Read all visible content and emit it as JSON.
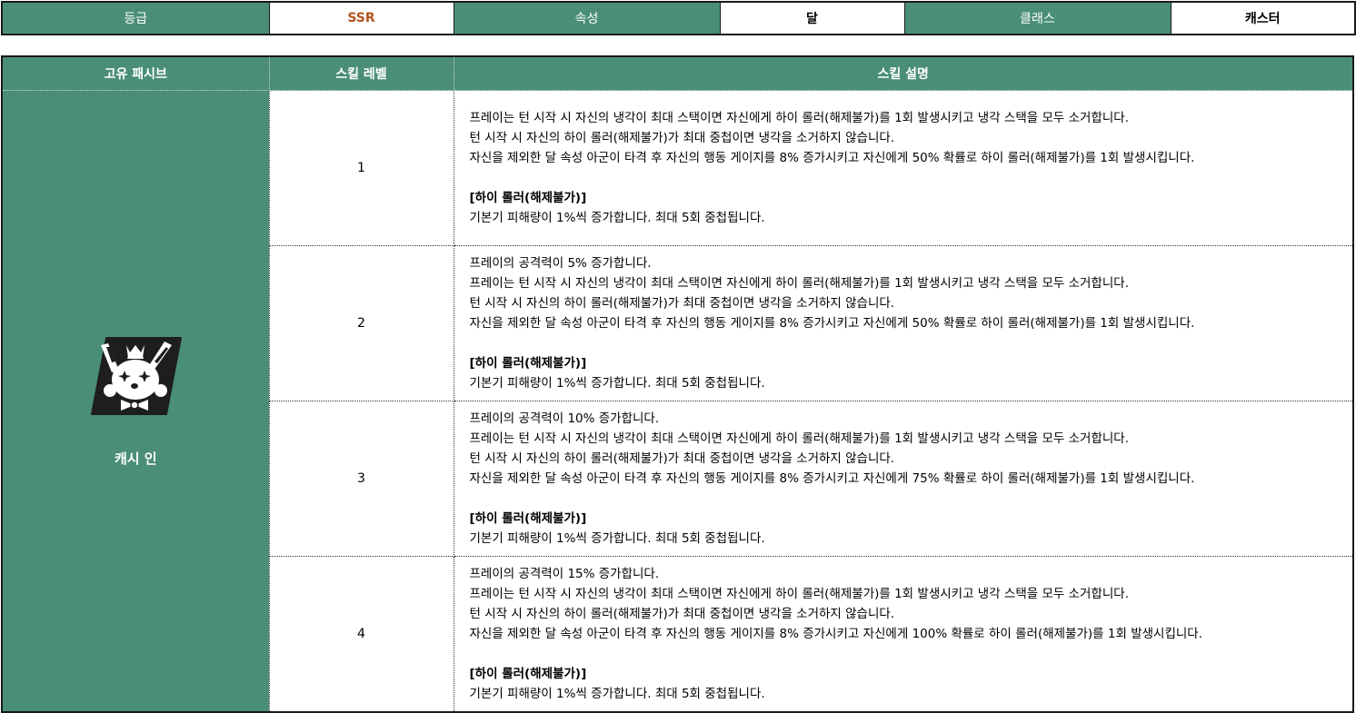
{
  "info": {
    "grade_label": "등급",
    "grade_value": "SSR",
    "attribute_label": "속성",
    "attribute_value": "달",
    "class_label": "클래스",
    "class_value": "캐스터"
  },
  "skill_table": {
    "headers": {
      "passive": "고유 패시브",
      "level": "스킬 레벨",
      "description": "스킬 설명"
    },
    "passive_name": "캐시 인",
    "passive_icon": "rabbit-card-icon",
    "rows": [
      {
        "level": "1",
        "lines": [
          "프레이는 턴 시작 시 자신의 냉각이 최대 스택이면 자신에게 하이 롤러(해제불가)를 1회 발생시키고 냉각 스택을 모두 소거합니다.",
          "턴 시작 시 자신의 하이 롤러(해제불가)가 최대 중첩이면 냉각을 소거하지 않습니다.",
          "자신을 제외한 달 속성 아군이 타격 후 자신의 행동 게이지를 8% 증가시키고 자신에게 50% 확률로 하이 롤러(해제불가)를 1회 발생시킵니다."
        ],
        "sub_title": "[하이 롤러(해제불가)]",
        "sub_text": "기본기 피해량이 1%씩 증가합니다. 최대 5회 중첩됩니다."
      },
      {
        "level": "2",
        "lines": [
          "프레이의 공격력이 5% 증가합니다.",
          "프레이는 턴 시작 시 자신의 냉각이 최대 스택이면 자신에게 하이 롤러(해제불가)를 1회 발생시키고 냉각 스택을 모두 소거합니다.",
          "턴 시작 시 자신의 하이 롤러(해제불가)가 최대 중첩이면 냉각을 소거하지 않습니다.",
          "자신을 제외한 달 속성 아군이 타격 후 자신의 행동 게이지를 8% 증가시키고 자신에게 50% 확률로 하이 롤러(해제불가)를 1회 발생시킵니다."
        ],
        "sub_title": "[하이 롤러(해제불가)]",
        "sub_text": "기본기 피해량이 1%씩 증가합니다. 최대 5회 중첩됩니다."
      },
      {
        "level": "3",
        "lines": [
          "프레이의 공격력이 10% 증가합니다.",
          "프레이는 턴 시작 시 자신의 냉각이 최대 스택이면 자신에게 하이 롤러(해제불가)를 1회 발생시키고 냉각 스택을 모두 소거합니다.",
          "턴 시작 시 자신의 하이 롤러(해제불가)가 최대 중첩이면 냉각을 소거하지 않습니다.",
          "자신을 제외한 달 속성 아군이 타격 후 자신의 행동 게이지를 8% 증가시키고 자신에게 75% 확률로 하이 롤러(해제불가)를 1회 발생시킵니다."
        ],
        "sub_title": "[하이 롤러(해제불가)]",
        "sub_text": "기본기 피해량이 1%씩 증가합니다. 최대 5회 중첩됩니다."
      },
      {
        "level": "4",
        "lines": [
          "프레이의 공격력이 15% 증가합니다.",
          "프레이는 턴 시작 시 자신의 냉각이 최대 스택이면 자신에게 하이 롤러(해제불가)를 1회 발생시키고 냉각 스택을 모두 소거합니다.",
          "턴 시작 시 자신의 하이 롤러(해제불가)가 최대 중첩이면 냉각을 소거하지 않습니다.",
          "자신을 제외한 달 속성 아군이 타격 후 자신의 행동 게이지를 8% 증가시키고 자신에게 100% 확률로 하이 롤러(해제불가)를 1회 발생시킵니다."
        ],
        "sub_title": "[하이 롤러(해제불가)]",
        "sub_text": "기본기 피해량이 1%씩 증가합니다. 최대 5회 중첩됩니다."
      }
    ]
  },
  "colors": {
    "header_green": "#4a8f75",
    "grade_orange": "#b3541e"
  }
}
